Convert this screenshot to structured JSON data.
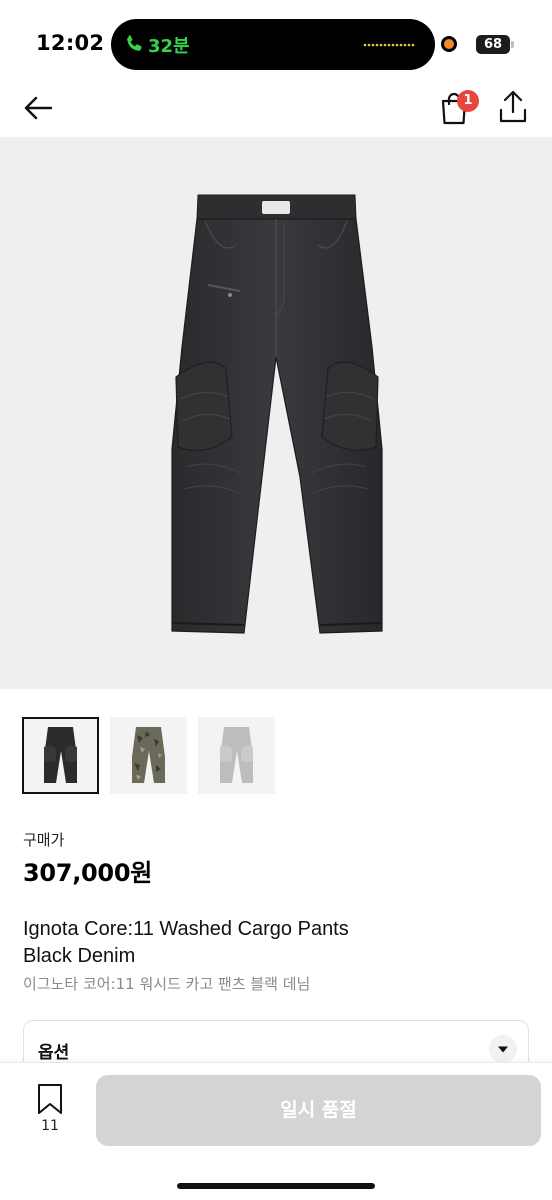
{
  "status_bar": {
    "time": "12:02",
    "call_duration": "32분",
    "battery_level": "68"
  },
  "nav": {
    "cart_badge_count": "1"
  },
  "gallery": {
    "thumbnails": [
      {
        "name": "black-denim",
        "color": "#2b2b2e",
        "selected": true
      },
      {
        "name": "camo",
        "color": "#6b6a5a",
        "selected": false
      },
      {
        "name": "light-grey",
        "color": "#bdbdbd",
        "selected": false
      }
    ]
  },
  "product": {
    "price_label": "구매가",
    "price": "307,000원",
    "title_en_line1": "Ignota Core:11 Washed Cargo Pants",
    "title_en_line2": "Black Denim",
    "title_ko": "이그노타 코어:11 워시드 카고 팬츠 블랙 데님"
  },
  "option": {
    "label": "옵션"
  },
  "bottom_bar": {
    "wishlist_count": "11",
    "cta_label": "일시 품절"
  },
  "colors": {
    "accent_badge": "#e8453c",
    "call_green": "#35d24a",
    "cta_disabled": "#d4d4d4",
    "hero_bg": "#efefef"
  }
}
